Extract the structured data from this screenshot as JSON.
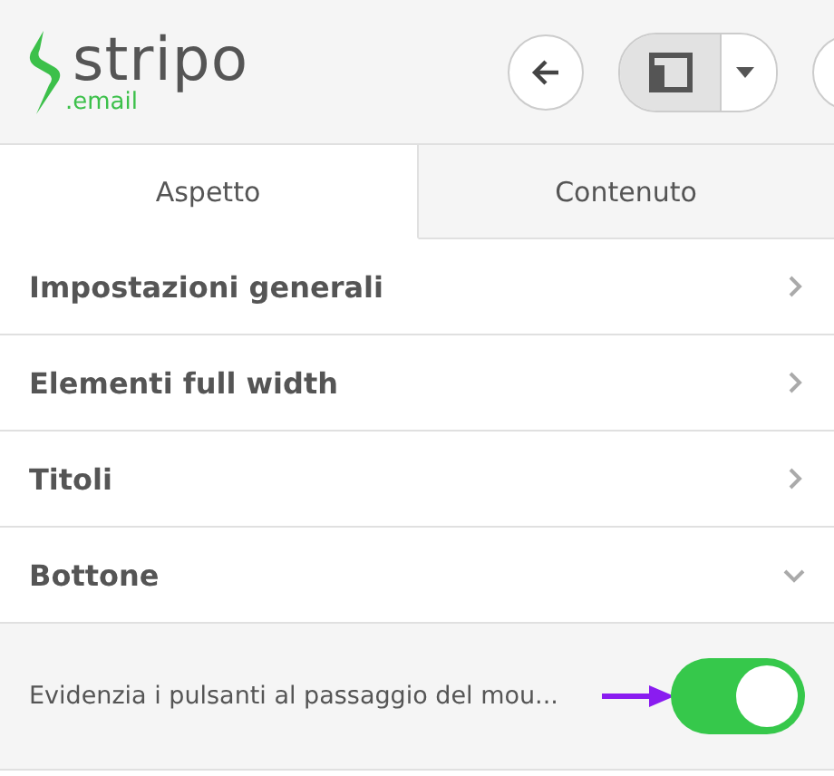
{
  "logo": {
    "name": "stripo",
    "suffix": ".email"
  },
  "toolbar": {
    "layout_selected": true
  },
  "tabs": [
    {
      "label": "Aspetto",
      "selected": true
    },
    {
      "label": "Contenuto",
      "selected": false
    }
  ],
  "sections": [
    {
      "title": "Impostazioni generali",
      "expanded": false
    },
    {
      "title": "Elementi full width",
      "expanded": false
    },
    {
      "title": "Titoli",
      "expanded": false
    },
    {
      "title": "Bottone",
      "expanded": true
    }
  ],
  "settings": [
    {
      "label": "Evidenzia i pulsanti al passaggio del mou...",
      "on": true
    }
  ]
}
